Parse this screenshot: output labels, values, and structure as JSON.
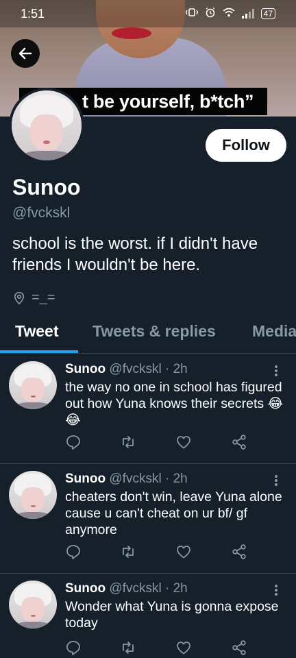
{
  "status_bar": {
    "time": "1:51",
    "battery": "47"
  },
  "banner": {
    "caption": "t be yourself, b*tch”"
  },
  "profile": {
    "name": "Sunoo",
    "handle": "@fvckskl",
    "bio": "school is the worst. if I didn't have friends I wouldn't be here.",
    "location": "=_=",
    "follow_label": "Follow"
  },
  "tabs": [
    {
      "label": "Tweet"
    },
    {
      "label": "Tweets & replies"
    },
    {
      "label": "Media"
    }
  ],
  "tweets": [
    {
      "name": "Sunoo",
      "handle": "@fvckskl",
      "time": "· 2h",
      "text": "the way no one in school has figured out how Yuna knows their secrets 😂😂"
    },
    {
      "name": "Sunoo",
      "handle": "@fvckskl",
      "time": "· 2h",
      "text": "cheaters don't win, leave Yuna alone cause u can't cheat on ur bf/ gf anymore"
    },
    {
      "name": "Sunoo",
      "handle": "@fvckskl",
      "time": "· 2h",
      "text": "Wonder what Yuna is gonna expose today"
    }
  ],
  "colors": {
    "background": "#15202b",
    "accent": "#1da1f2",
    "muted": "#8899a6",
    "divider": "#38444d"
  }
}
